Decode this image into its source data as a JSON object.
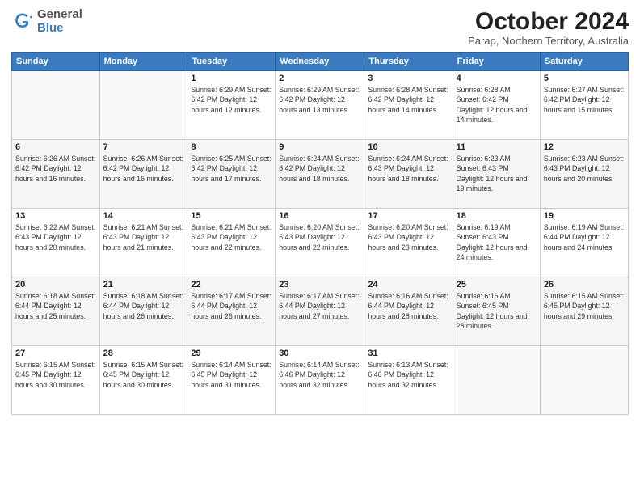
{
  "header": {
    "logo_general": "General",
    "logo_blue": "Blue",
    "month_title": "October 2024",
    "subtitle": "Parap, Northern Territory, Australia"
  },
  "days_of_week": [
    "Sunday",
    "Monday",
    "Tuesday",
    "Wednesday",
    "Thursday",
    "Friday",
    "Saturday"
  ],
  "weeks": [
    [
      {
        "day": "",
        "info": ""
      },
      {
        "day": "",
        "info": ""
      },
      {
        "day": "1",
        "info": "Sunrise: 6:29 AM\nSunset: 6:42 PM\nDaylight: 12 hours\nand 12 minutes."
      },
      {
        "day": "2",
        "info": "Sunrise: 6:29 AM\nSunset: 6:42 PM\nDaylight: 12 hours\nand 13 minutes."
      },
      {
        "day": "3",
        "info": "Sunrise: 6:28 AM\nSunset: 6:42 PM\nDaylight: 12 hours\nand 14 minutes."
      },
      {
        "day": "4",
        "info": "Sunrise: 6:28 AM\nSunset: 6:42 PM\nDaylight: 12 hours\nand 14 minutes."
      },
      {
        "day": "5",
        "info": "Sunrise: 6:27 AM\nSunset: 6:42 PM\nDaylight: 12 hours\nand 15 minutes."
      }
    ],
    [
      {
        "day": "6",
        "info": "Sunrise: 6:26 AM\nSunset: 6:42 PM\nDaylight: 12 hours\nand 16 minutes."
      },
      {
        "day": "7",
        "info": "Sunrise: 6:26 AM\nSunset: 6:42 PM\nDaylight: 12 hours\nand 16 minutes."
      },
      {
        "day": "8",
        "info": "Sunrise: 6:25 AM\nSunset: 6:42 PM\nDaylight: 12 hours\nand 17 minutes."
      },
      {
        "day": "9",
        "info": "Sunrise: 6:24 AM\nSunset: 6:42 PM\nDaylight: 12 hours\nand 18 minutes."
      },
      {
        "day": "10",
        "info": "Sunrise: 6:24 AM\nSunset: 6:43 PM\nDaylight: 12 hours\nand 18 minutes."
      },
      {
        "day": "11",
        "info": "Sunrise: 6:23 AM\nSunset: 6:43 PM\nDaylight: 12 hours\nand 19 minutes."
      },
      {
        "day": "12",
        "info": "Sunrise: 6:23 AM\nSunset: 6:43 PM\nDaylight: 12 hours\nand 20 minutes."
      }
    ],
    [
      {
        "day": "13",
        "info": "Sunrise: 6:22 AM\nSunset: 6:43 PM\nDaylight: 12 hours\nand 20 minutes."
      },
      {
        "day": "14",
        "info": "Sunrise: 6:21 AM\nSunset: 6:43 PM\nDaylight: 12 hours\nand 21 minutes."
      },
      {
        "day": "15",
        "info": "Sunrise: 6:21 AM\nSunset: 6:43 PM\nDaylight: 12 hours\nand 22 minutes."
      },
      {
        "day": "16",
        "info": "Sunrise: 6:20 AM\nSunset: 6:43 PM\nDaylight: 12 hours\nand 22 minutes."
      },
      {
        "day": "17",
        "info": "Sunrise: 6:20 AM\nSunset: 6:43 PM\nDaylight: 12 hours\nand 23 minutes."
      },
      {
        "day": "18",
        "info": "Sunrise: 6:19 AM\nSunset: 6:43 PM\nDaylight: 12 hours\nand 24 minutes."
      },
      {
        "day": "19",
        "info": "Sunrise: 6:19 AM\nSunset: 6:44 PM\nDaylight: 12 hours\nand 24 minutes."
      }
    ],
    [
      {
        "day": "20",
        "info": "Sunrise: 6:18 AM\nSunset: 6:44 PM\nDaylight: 12 hours\nand 25 minutes."
      },
      {
        "day": "21",
        "info": "Sunrise: 6:18 AM\nSunset: 6:44 PM\nDaylight: 12 hours\nand 26 minutes."
      },
      {
        "day": "22",
        "info": "Sunrise: 6:17 AM\nSunset: 6:44 PM\nDaylight: 12 hours\nand 26 minutes."
      },
      {
        "day": "23",
        "info": "Sunrise: 6:17 AM\nSunset: 6:44 PM\nDaylight: 12 hours\nand 27 minutes."
      },
      {
        "day": "24",
        "info": "Sunrise: 6:16 AM\nSunset: 6:44 PM\nDaylight: 12 hours\nand 28 minutes."
      },
      {
        "day": "25",
        "info": "Sunrise: 6:16 AM\nSunset: 6:45 PM\nDaylight: 12 hours\nand 28 minutes."
      },
      {
        "day": "26",
        "info": "Sunrise: 6:15 AM\nSunset: 6:45 PM\nDaylight: 12 hours\nand 29 minutes."
      }
    ],
    [
      {
        "day": "27",
        "info": "Sunrise: 6:15 AM\nSunset: 6:45 PM\nDaylight: 12 hours\nand 30 minutes."
      },
      {
        "day": "28",
        "info": "Sunrise: 6:15 AM\nSunset: 6:45 PM\nDaylight: 12 hours\nand 30 minutes."
      },
      {
        "day": "29",
        "info": "Sunrise: 6:14 AM\nSunset: 6:45 PM\nDaylight: 12 hours\nand 31 minutes."
      },
      {
        "day": "30",
        "info": "Sunrise: 6:14 AM\nSunset: 6:46 PM\nDaylight: 12 hours\nand 32 minutes."
      },
      {
        "day": "31",
        "info": "Sunrise: 6:13 AM\nSunset: 6:46 PM\nDaylight: 12 hours\nand 32 minutes."
      },
      {
        "day": "",
        "info": ""
      },
      {
        "day": "",
        "info": ""
      }
    ]
  ]
}
